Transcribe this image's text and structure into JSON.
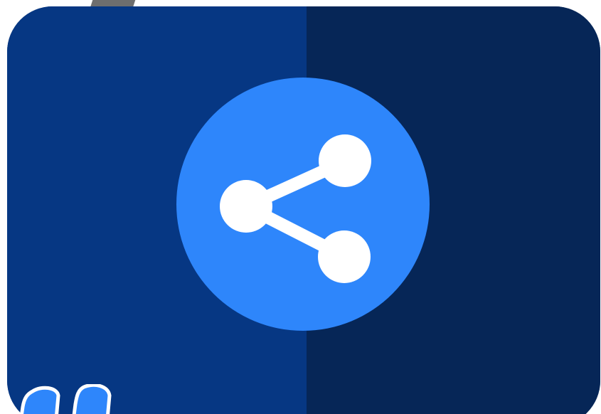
{
  "colors": {
    "panel_left": "#063783",
    "panel_right": "#062657",
    "share_circle": "#2e86fb",
    "share_glyph": "#ffffff",
    "corner_mark": "#2e86fb"
  },
  "icons": {
    "main": "share-icon",
    "corner": "partial-quote-mark-icon"
  }
}
